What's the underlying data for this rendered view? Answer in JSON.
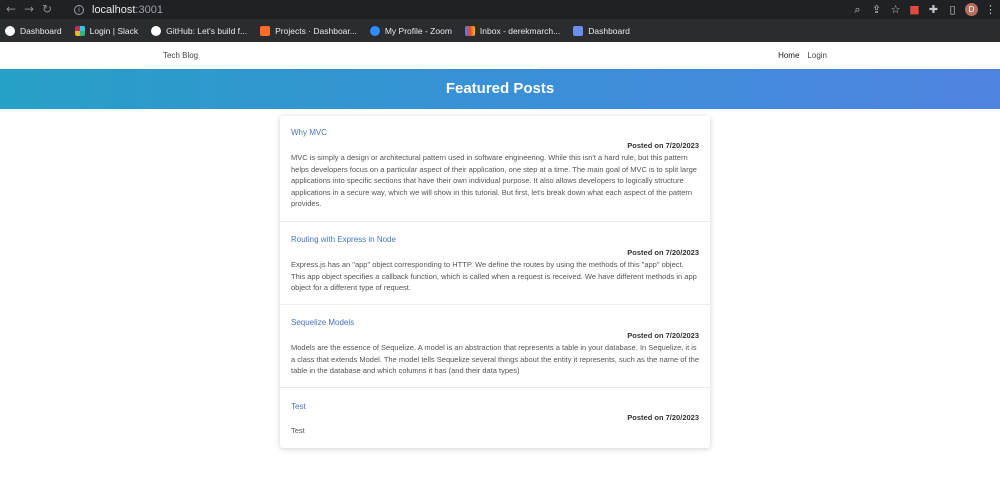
{
  "browser": {
    "url_host": "localhost",
    "url_port": ":3001",
    "avatar_letter": "D",
    "bookmarks": [
      {
        "label": "Dashboard",
        "icon": "github-icon",
        "color": "#ffffff"
      },
      {
        "label": "Login | Slack",
        "icon": "slack-icon",
        "color": "#e01e5a"
      },
      {
        "label": "GitHub: Let's build f...",
        "icon": "github-icon",
        "color": "#ffffff"
      },
      {
        "label": "Projects · Dashboar...",
        "icon": "gitlab-icon",
        "color": "#fc6d26"
      },
      {
        "label": "My Profile - Zoom",
        "icon": "zoom-icon",
        "color": "#2d8cff"
      },
      {
        "label": "Inbox - derekmarch...",
        "icon": "gmail-icon",
        "color": "#ea4335"
      },
      {
        "label": "Dashboard",
        "icon": "dashboard-icon",
        "color": "#6b8ff0"
      }
    ]
  },
  "site": {
    "brand": "Tech Blog",
    "nav": {
      "home": "Home",
      "login": "Login"
    },
    "hero_title": "Featured Posts"
  },
  "posts": [
    {
      "title": "Why MVC",
      "date": "Posted on 7/20/2023",
      "body": "MVC is simply a design or architectural pattern used in software engineering. While this isn't a hard rule, but this pattern helps developers focus on a particular aspect of their application, one step at a time. The main goal of MVC is to split large applications into specific sections that have their own individual purpose. It also allows developers to logically structure applications in a secure way, which we will show in this tutorial. But first, let's break down what each aspect of the pattern provides."
    },
    {
      "title": "Routing with Express in Node",
      "date": "Posted on 7/20/2023",
      "body": "Express.js has an \"app\" object corresponding to HTTP. We define the routes by using the methods of this \"app\" object. This app object specifies a callback function, which is called when a request is received. We have different methods in app object for a different type of request."
    },
    {
      "title": "Sequelize Models",
      "date": "Posted on 7/20/2023",
      "body": "Models are the essence of Sequelize. A model is an abstraction that represents a table in your database. In Sequelize, it is a class that extends Model. The model tells Sequelize several things about the entity it represents, such as the name of the table in the database and which columns it has (and their data types)"
    },
    {
      "title": "Test",
      "date": "Posted on 7/20/2023",
      "body": "Test"
    }
  ]
}
